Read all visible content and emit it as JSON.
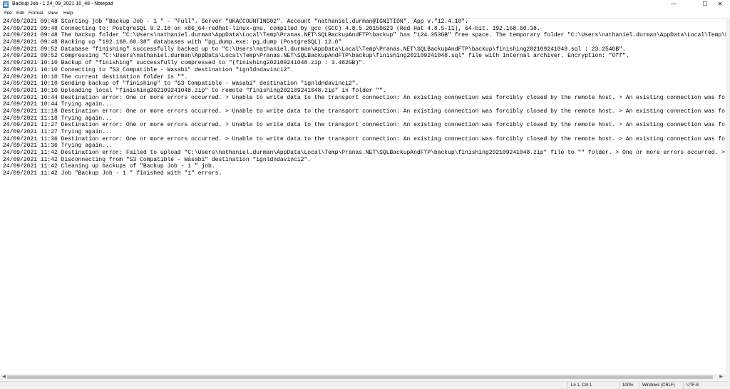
{
  "window": {
    "title": "Backup Job - 1  24_09_2021 10_48 - Notepad",
    "minimize": "—",
    "maximize": "☐",
    "close": "✕"
  },
  "menu": [
    "File",
    "Edit",
    "Format",
    "View",
    "Help"
  ],
  "log_lines": [
    "24/09/2021 09:48 Starting job \"Backup Job - 1 \" - \"Full\". Server \"UKACCOUNTING02\". Account \"nathaniel.durman@IGNITION\". App v.\"12.4.10\".",
    "24/09/2021 09:48 Connecting to: PostgreSQL 9.2.18 on x86_64-redhat-linux-gnu, compiled by gcc (GCC) 4.8.5 20150623 (Red Hat 4.8.5-11), 64-bit. 192.168.60.38.",
    "24/09/2021 09:48 The backup folder \"C:\\Users\\nathaniel.durman\\AppData\\Local\\Temp\\Pranas.NET\\SQLBackupAndFTP\\backup\" has \"124.353GB\" free space. The temporary folder \"C:\\Users\\nathaniel.durman\\AppData\\Local\\Temp\\Pranas.NET\\SQLBackupAndF",
    "24/09/2021 09:48 Backing up \"192.168.60.38\" databases with \"pg_dump.exe: pg_dump (PostgreSQL) 12.0\"",
    "24/09/2021 09:52 Database \"finishing\" successfully backed up to \"C:\\Users\\nathaniel.durman\\AppData\\Local\\Temp\\Pranas.NET\\SQLBackupAndFTP\\backup\\finishing202109241048.sql : 23.254GB\".",
    "24/09/2021 09:52 Compressing \"C:\\Users\\nathaniel.durman\\AppData\\Local\\Temp\\Pranas.NET\\SQLBackupAndFTP\\backup\\finishing202109241048.sql\" file with Internal archiver. Encryption: \"Off\".",
    "24/09/2021 10:10 Backup of \"finishing\" successfully compressed to \"(finishing202109241048.zip : 3.482GB)\".",
    "24/09/2021 10:10 Connecting to \"S3 Compatible - Wasabi\" destination \"ignldndavinci2\".",
    "24/09/2021 10:10 The current destination folder is \"\".",
    "24/09/2021 10:10 Sending backup of \"finishing\" to \"S3 Compatible - Wasabi\" destination \"ignldndavinci2\".",
    "24/09/2021 10:10 Uploading local \"finishing202109241048.zip\" to remote \"finishing202109241048.zip\" in folder \"\".",
    "24/09/2021 10:44 Destination error: One or more errors occurred. > Unable to write data to the transport connection: An existing connection was forcibly closed by the remote host. > An existing connection was forcibly closed by the rem",
    "24/09/2021 10:44 Trying again...",
    "24/09/2021 11:18 Destination error: One or more errors occurred. > Unable to write data to the transport connection: An existing connection was forcibly closed by the remote host. > An existing connection was forcibly closed by the rem",
    "24/09/2021 11:18 Trying again...",
    "24/09/2021 11:27 Destination error: One or more errors occurred. > Unable to write data to the transport connection: An existing connection was forcibly closed by the remote host. > An existing connection was forcibly closed by the rem",
    "24/09/2021 11:27 Trying again...",
    "24/09/2021 11:36 Destination error: One or more errors occurred. > Unable to write data to the transport connection: An existing connection was forcibly closed by the remote host. > An existing connection was forcibly closed by the rem",
    "24/09/2021 11:36 Trying again...",
    "24/09/2021 11:42 Destination error: Failed to upload \"C:\\Users\\nathaniel.durman\\AppData\\Local\\Temp\\Pranas.NET\\SQLBackupAndFTP\\backup\\finishing202109241048.zip\" file to \"\" folder. > One or more errors occurred. > Unable to write data to",
    "24/09/2021 11:42 Disconnecting from \"S3 Compatible - Wasabi\" destination \"ignldndavinci2\".",
    "24/09/2021 11:42 Cleaning up backups of \"Backup Job - 1 \" job.",
    "24/09/2021 11:42 Job \"Backup Job - 1 \" finished with \"1\" errors."
  ],
  "status": {
    "position": "Ln 1, Col 1",
    "zoom": "100%",
    "line_ending": "Windows (CRLF)",
    "encoding": "UTF-8"
  },
  "icons": {
    "app": "notepad-icon",
    "scroll_left": "◀",
    "scroll_right": "▶"
  }
}
